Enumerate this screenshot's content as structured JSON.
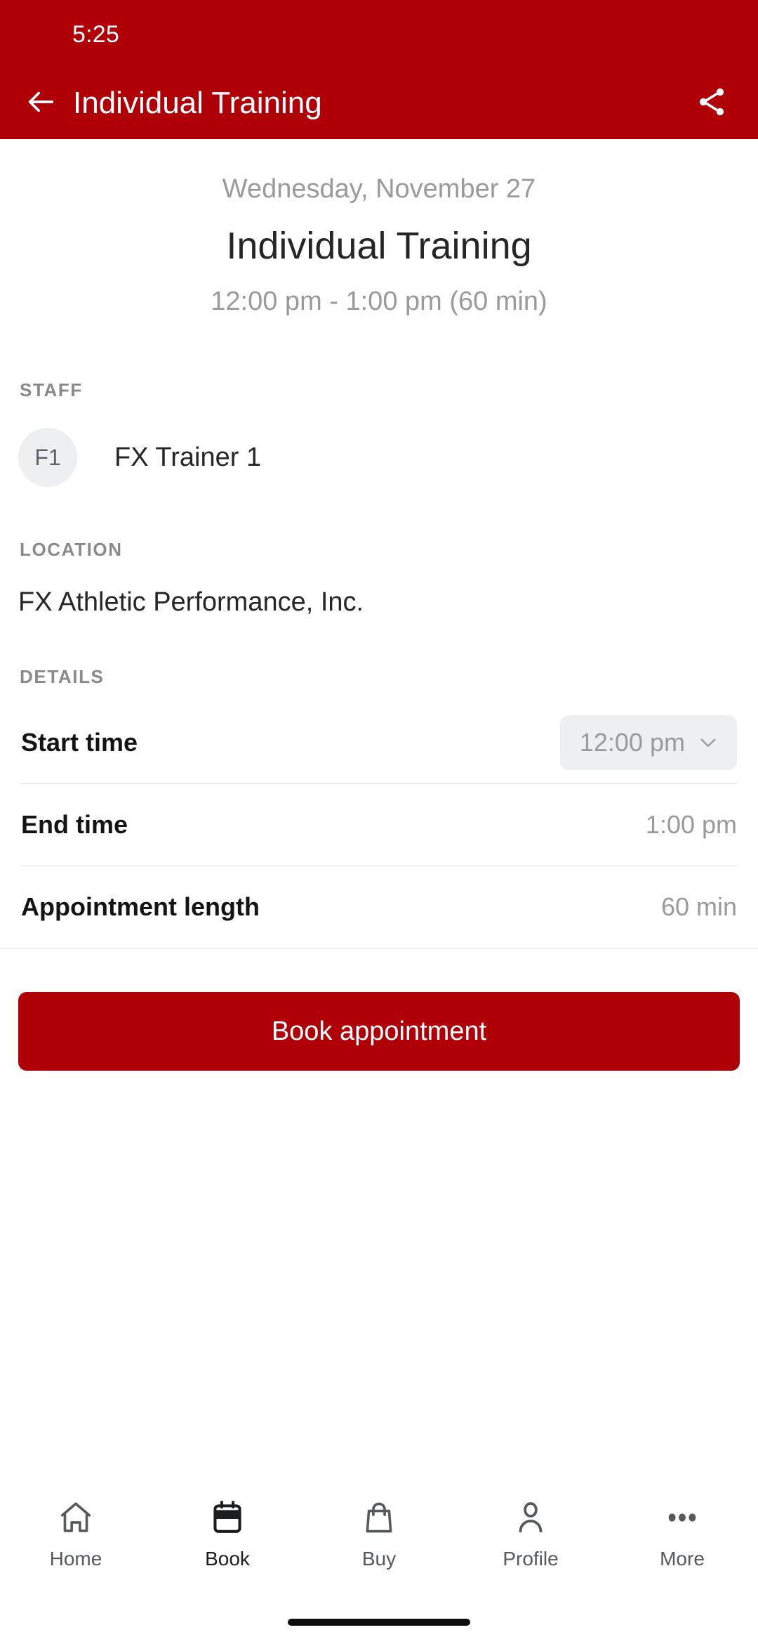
{
  "status_bar": {
    "time": "5:25"
  },
  "app_bar": {
    "title": "Individual Training",
    "back_icon": "arrow-left-icon",
    "share_icon": "share-icon",
    "background_color": "#AF0008"
  },
  "hero": {
    "date": "Wednesday, November 27",
    "title": "Individual Training",
    "time_range": "12:00 pm - 1:00 pm (60 min)"
  },
  "staff": {
    "label": "STAFF",
    "avatar_initials": "F1",
    "name": "FX Trainer 1"
  },
  "location": {
    "label": "LOCATION",
    "value": "FX Athletic Performance, Inc."
  },
  "details": {
    "label": "DETAILS",
    "rows": [
      {
        "key": "Start time",
        "value": "12:00 pm",
        "type": "dropdown",
        "chevron_icon": "chevron-down-icon"
      },
      {
        "key": "End time",
        "value": "1:00 pm",
        "type": "text"
      },
      {
        "key": "Appointment length",
        "value": "60 min",
        "type": "text"
      }
    ]
  },
  "cta": {
    "label": "Book appointment",
    "background_color": "#AF0008",
    "text_color": "#FFFFFF"
  },
  "bottom_nav": {
    "active_index": 1,
    "items": [
      {
        "label": "Home",
        "icon": "home-icon"
      },
      {
        "label": "Book",
        "icon": "calendar-icon"
      },
      {
        "label": "Buy",
        "icon": "shopping-bag-icon"
      },
      {
        "label": "Profile",
        "icon": "person-icon"
      },
      {
        "label": "More",
        "icon": "ellipsis-icon"
      }
    ]
  },
  "colors": {
    "brand_red": "#AF0008",
    "muted_gray": "#9A9A9A",
    "label_gray": "#8A8A8A",
    "text_dark": "#262626",
    "pill_bg": "#EDEFF1",
    "divider": "#DEDEDE"
  }
}
